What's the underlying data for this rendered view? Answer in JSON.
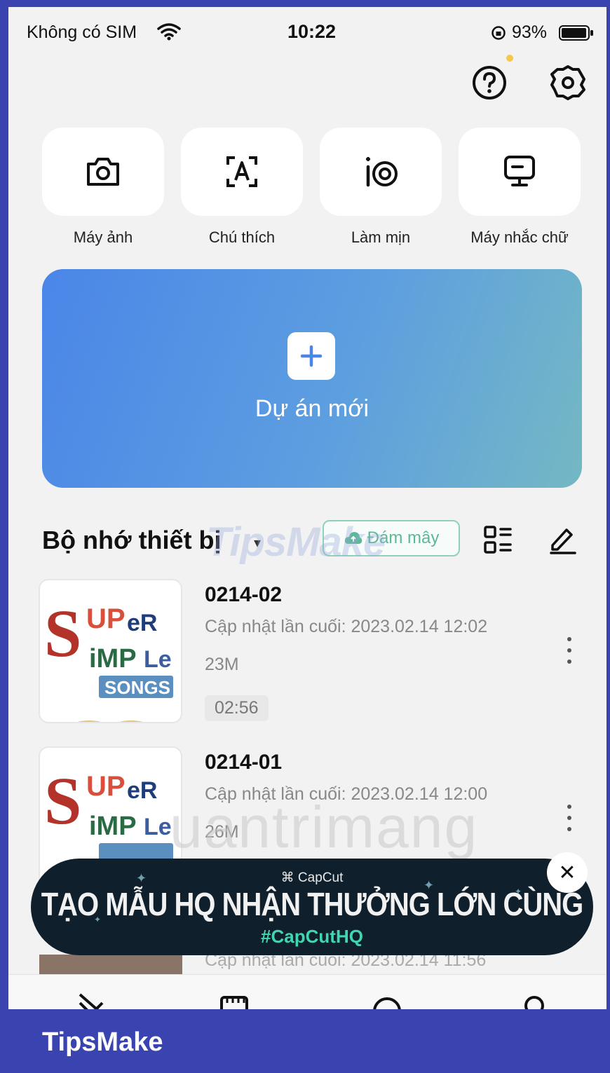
{
  "status_bar": {
    "carrier": "Không có SIM",
    "time": "10:22",
    "battery": "93%"
  },
  "header_icons": {
    "help": "question-circle-icon",
    "settings": "gear-icon"
  },
  "tools": [
    {
      "label": "Máy ảnh",
      "icon": "camera-icon"
    },
    {
      "label": "Chú thích",
      "icon": "caption-icon"
    },
    {
      "label": "Làm mịn",
      "icon": "retouch-icon"
    },
    {
      "label": "Máy nhắc chữ",
      "icon": "teleprompter-icon"
    }
  ],
  "new_project": {
    "label": "Dự án mới"
  },
  "section": {
    "title": "Bộ nhớ thiết bị",
    "cloud_label": "Đám mây"
  },
  "projects": [
    {
      "name": "0214-02",
      "updated": "Cập nhật lần cuối: 2023.02.14 12:02",
      "size": "23M",
      "duration": "02:56"
    },
    {
      "name": "0214-01",
      "updated": "Cập nhật lần cuối: 2023.02.14 12:00",
      "size": "26M"
    }
  ],
  "thumbnail_logo": {
    "line1": "SUPER",
    "line2": "SIMPLE",
    "line3": "SONGS"
  },
  "peek_row": {
    "updated": "Cập nhật lần cuối: 2023.02.14 11:56"
  },
  "banner": {
    "logo": "CapCut",
    "title": "TẠO MẪU HQ NHẬN THƯỞNG LỚN CÙNG",
    "hashtag": "#CapCutHQ",
    "close": "✕"
  },
  "watermarks": {
    "tipsmake": "TipsMake",
    "quantrimang": "uantrimang"
  },
  "footer": {
    "brand": "TipsMake"
  },
  "colors": {
    "frame": "#3a44b0",
    "accent": "#4a86e8",
    "cloud": "#5cb896",
    "banner_tag": "#3fd7b0"
  }
}
